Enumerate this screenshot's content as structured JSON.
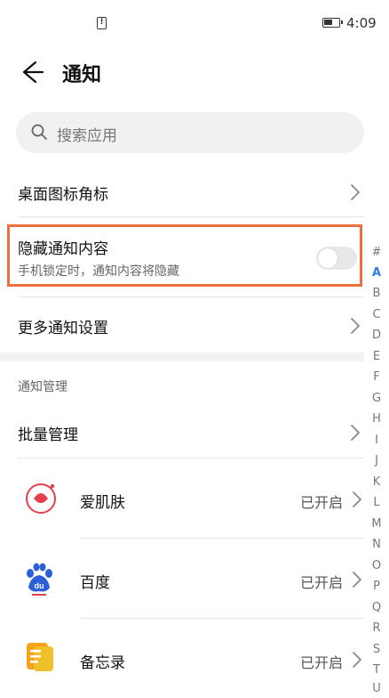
{
  "status_bar": {
    "time": "4:09",
    "notification_glyph": "!"
  },
  "header": {
    "title": "通知"
  },
  "search": {
    "placeholder": "搜索应用"
  },
  "rows": {
    "badge": {
      "label": "桌面图标角标"
    },
    "hide": {
      "label": "隐藏通知内容",
      "sub": "手机锁定时，通知内容将隐藏"
    },
    "more": {
      "label": "更多通知设置"
    }
  },
  "section_title": "通知管理",
  "batch": {
    "label": "批量管理"
  },
  "apps": [
    {
      "name": "爱肌肤",
      "status": "已开启"
    },
    {
      "name": "百度",
      "status": "已开启"
    },
    {
      "name": "备忘录",
      "status": "已开启"
    }
  ],
  "index_letters": [
    "#",
    "A",
    "B",
    "C",
    "D",
    "E",
    "F",
    "G",
    "H",
    "I",
    "J",
    "K",
    "L",
    "M",
    "N",
    "O",
    "P",
    "Q",
    "R",
    "S",
    "T",
    "U"
  ],
  "colors": {
    "highlight": "#ef6e3f",
    "index_active": "#2f7ce6"
  }
}
